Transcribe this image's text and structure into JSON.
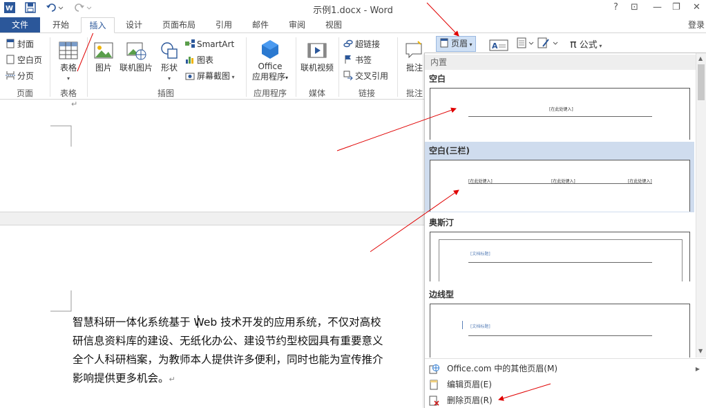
{
  "titlebar": {
    "title": "示例1.docx - Word",
    "help": "?",
    "restore_ribbon": "⊡",
    "minimize": "—",
    "maximize": "❐",
    "close": "✕"
  },
  "tabs": {
    "file": "文件",
    "home": "开始",
    "insert": "插入",
    "design": "设计",
    "layout": "页面布局",
    "references": "引用",
    "mailings": "邮件",
    "review": "审阅",
    "view": "视图",
    "login": "登录"
  },
  "ribbon": {
    "pages": {
      "cover": "封面",
      "blank": "空白页",
      "break": "分页",
      "label": "页面"
    },
    "tables": {
      "table": "表格",
      "label": "表格"
    },
    "illustrations": {
      "pictures": "图片",
      "online_pictures": "联机图片",
      "shapes": "形状",
      "smartart": "SmartArt",
      "chart": "图表",
      "screenshot": "屏幕截图",
      "label": "插图"
    },
    "apps": {
      "office_line1": "Office",
      "office_line2": "应用程序",
      "label": "应用程序"
    },
    "media": {
      "online_video": "联机视频",
      "label": "媒体"
    },
    "links": {
      "hyperlink": "超链接",
      "bookmark": "书签",
      "crossref": "交叉引用",
      "label": "链接"
    },
    "comments": {
      "comment": "批注",
      "label": "批注"
    },
    "header_button": "页眉",
    "formula": "公式"
  },
  "document": {
    "lines": [
      "智慧科研一体化系统基于 Web 技术开发的应用系统，不仅对高校",
      "研信息资料库的建设、无纸化办公、建设节约型校园具有重要意义",
      "全个人科研档案，为教师本人提供许多便利，同时也能为宣传推介",
      "影响提供更多机会。"
    ],
    "para_mark": "↵"
  },
  "dropdown": {
    "section_builtin": "内置",
    "items": [
      {
        "title": "空白",
        "placeholders": [
          "[在此处键入]"
        ]
      },
      {
        "title": "空白(三栏)",
        "placeholders": [
          "[在此处键入]",
          "[在此处键入]",
          "[在此处键入]"
        ]
      },
      {
        "title": "奥斯汀",
        "placeholders": [
          "[文档标题]"
        ]
      },
      {
        "title": "边线型",
        "placeholders": [
          "[文档标题]"
        ]
      }
    ],
    "commands": {
      "more_office": "Office.com 中的其他页眉(M)",
      "edit_header": "编辑页眉(E)",
      "remove_header": "删除页眉(R)"
    }
  },
  "colors": {
    "accent": "#2b579a",
    "highlight": "#cfdcee",
    "annotation_arrow": "#e00000"
  }
}
